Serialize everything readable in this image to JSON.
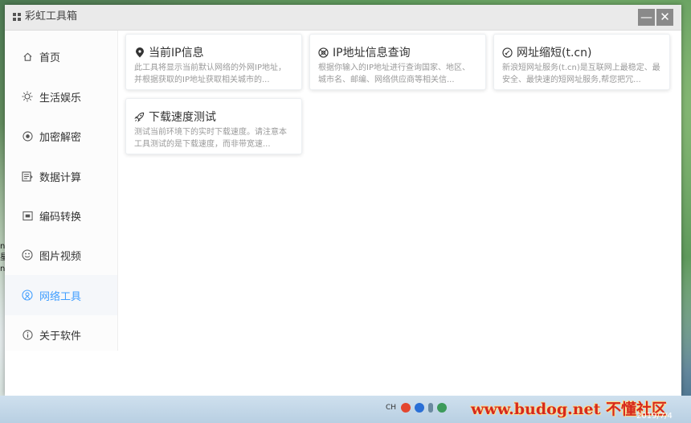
{
  "window": {
    "title": "彩虹工具箱",
    "minimize_symbol": "—",
    "close_symbol": "✕"
  },
  "sidebar": {
    "items": [
      {
        "label": "首页",
        "icon": "home-icon"
      },
      {
        "label": "生活娱乐",
        "icon": "sun-icon"
      },
      {
        "label": "加密解密",
        "icon": "lock-circle-icon"
      },
      {
        "label": "数据计算",
        "icon": "calculator-icon"
      },
      {
        "label": "编码转换",
        "icon": "code-box-icon"
      },
      {
        "label": "图片视频",
        "icon": "smile-image-icon"
      },
      {
        "label": "网络工具",
        "icon": "network-icon",
        "active": true
      },
      {
        "label": "关于软件",
        "icon": "info-icon"
      }
    ]
  },
  "cards": [
    {
      "title": "当前IP信息",
      "icon": "location-pin-icon",
      "desc": "此工具将显示当前默认网络的外网IP地址，并根据获取的IP地址获取相关城市的..."
    },
    {
      "title": "IP地址信息查询",
      "icon": "globe-icon",
      "desc": "根据你输入的IP地址进行查询国家、地区、城市名、邮编、网络供应商等相关信..."
    },
    {
      "title": "网址缩短(t.cn)",
      "icon": "link-circle-icon",
      "desc": "新浪短网址服务(t.cn)是互联网上最稳定、最安全、最快速的短网址服务,帮您把冗..."
    },
    {
      "title": "下载速度测试",
      "icon": "rocket-icon",
      "desc": "测试当前环境下的实时下载速度。请注意本工具测试的是下载速度，而非带宽速..."
    }
  ],
  "taskbar": {
    "ime": "CH",
    "watermark": "www.budog.net 不懂社区",
    "date": "2019/7/4"
  },
  "desktop": {
    "edge_chars": "n 星 n"
  },
  "colors": {
    "accent": "#409eff",
    "titlebar": "#eaeaea",
    "sidebar_active_bg": "#f5f7fa"
  }
}
